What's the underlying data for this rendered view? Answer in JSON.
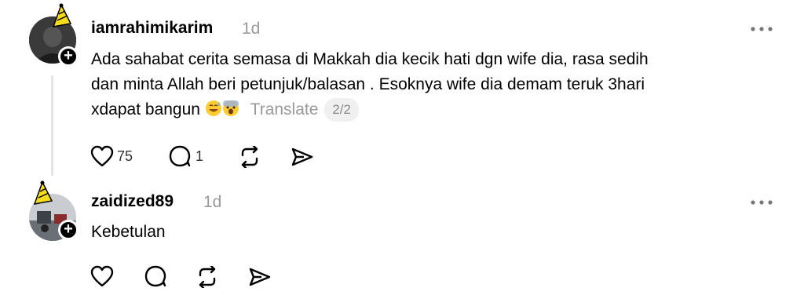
{
  "comments": [
    {
      "username": "iamrahimikarim",
      "time": "1d",
      "text_line1": "Ada sahabat cerita semasa di Makkah dia kecik hati dgn wife dia, rasa sedih",
      "text_line2": "dan minta Allah beri petunjuk/balasan . Esoknya wife dia demam teruk 3hari",
      "text_line3": "xdapat bangun",
      "translate_label": "Translate",
      "pager": "2/2",
      "likes": "75",
      "replies": "1"
    },
    {
      "username": "zaidized89",
      "time": "1d",
      "text": "Kebetulan"
    }
  ],
  "icons": {
    "like": "heart-icon",
    "reply": "comment-icon",
    "repost": "repost-icon",
    "share": "share-icon",
    "more": "more-options-icon",
    "follow": "plus-icon",
    "hat": "party-hat-icon"
  },
  "colors": {
    "text": "#000000",
    "muted": "#999999",
    "badge_bg": "#f0f0f0",
    "hat_yellow": "#f5dd1e"
  }
}
